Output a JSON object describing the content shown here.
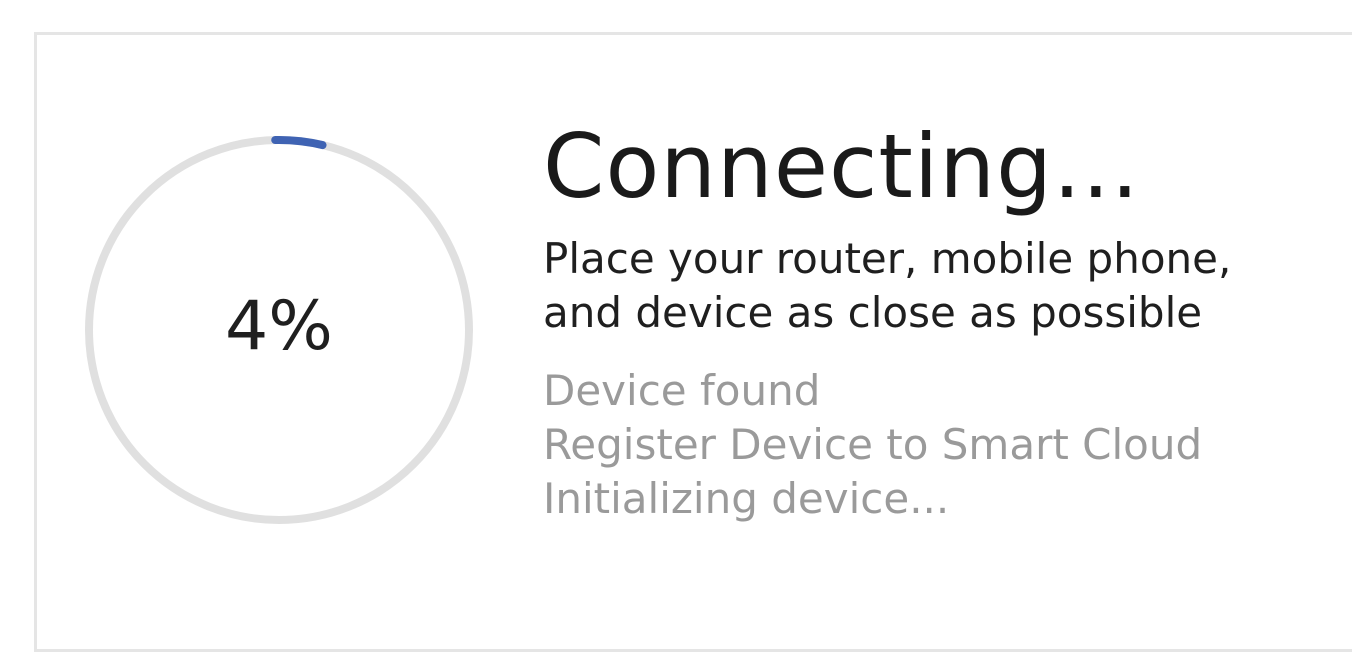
{
  "progress": {
    "percent_label": "4%",
    "value": 0.04,
    "track_color": "#e0e0e0",
    "fill_color": "#3f63b3"
  },
  "status": {
    "title": "Connecting...",
    "subtitle_line1": "Place your router, mobile phone,",
    "subtitle_line2": "and device as close as possible"
  },
  "steps": [
    "Device found",
    "Register Device to Smart Cloud",
    "Initializing device..."
  ]
}
